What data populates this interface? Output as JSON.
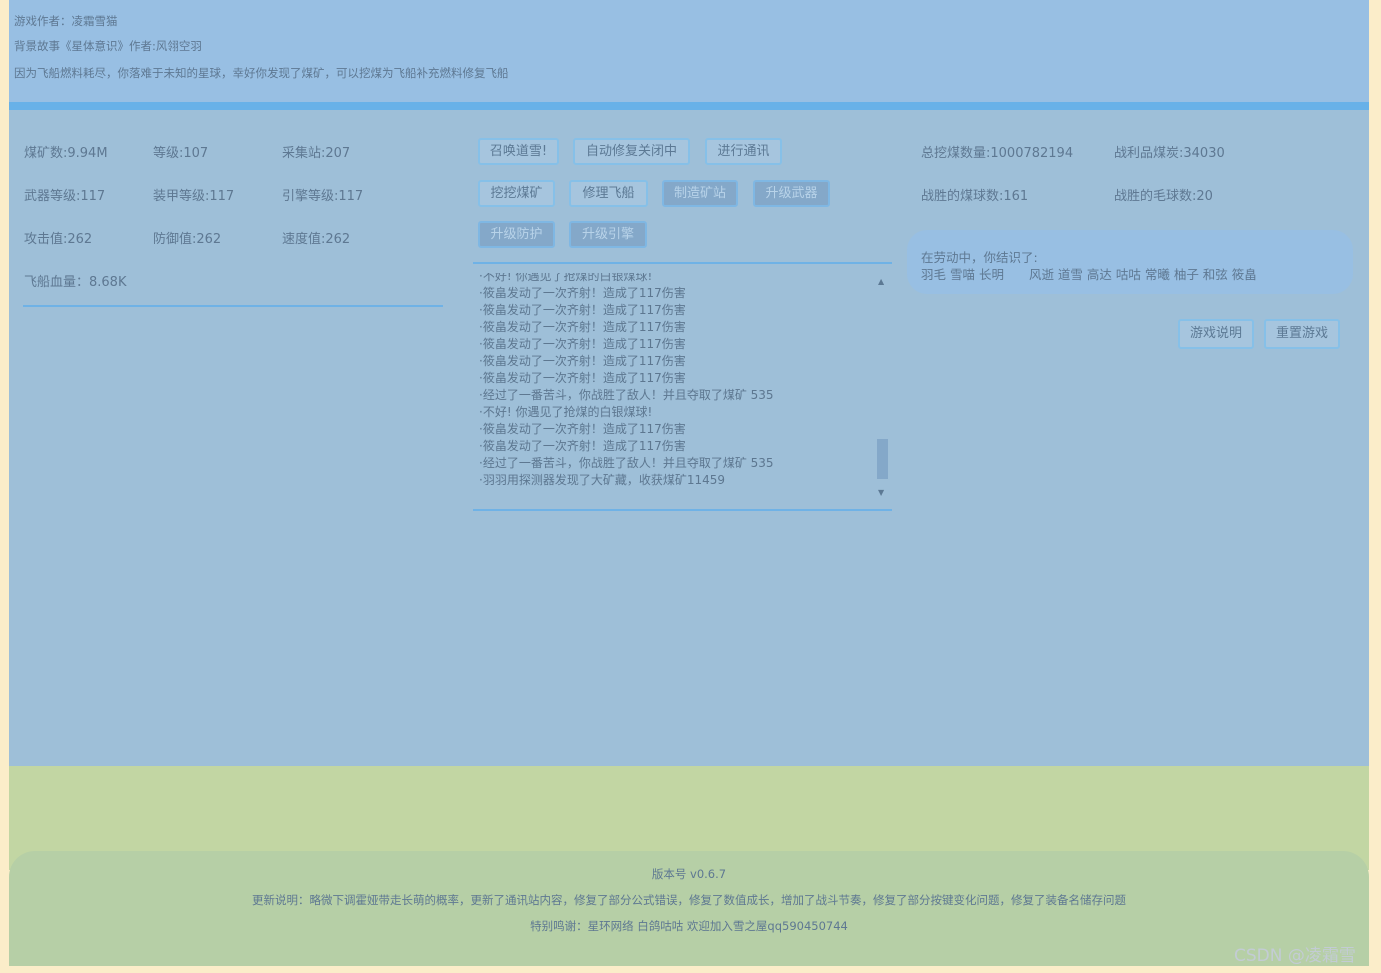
{
  "header": {
    "author": "游戏作者：凌霜雪猫",
    "story": "背景故事《星体意识》作者:风翎空羽",
    "intro": "因为飞船燃料耗尽，你落难于未知的星球，幸好你发现了煤矿，可以挖煤为飞船补充燃料修复飞船"
  },
  "stats": {
    "coal": "煤矿数:9.94M",
    "level": "等级:107",
    "stations": "采集站:207",
    "weapon": "武器等级:117",
    "armor": "装甲等级:117",
    "engine": "引擎等级:117",
    "attack": "攻击值:262",
    "defense": "防御值:262",
    "speed": "速度值:262",
    "hp": "飞船血量：8.68K"
  },
  "buttons": {
    "summon": "召唤道雪!",
    "autorepair": "自动修复关闭中",
    "comm": "进行通讯",
    "mine": "挖挖煤矿",
    "repair": "修理飞船",
    "build": "制造矿站",
    "upgrade_weapon": "升级武器",
    "upgrade_defense": "升级防护",
    "upgrade_engine": "升级引擎",
    "help": "游戏说明",
    "reset": "重置游戏"
  },
  "log": [
    "·不好! 你遇见了抢煤的白银煤球!",
    "·筱畠发动了一次齐射！造成了117伤害",
    "·筱畠发动了一次齐射！造成了117伤害",
    "·筱畠发动了一次齐射！造成了117伤害",
    "·筱畠发动了一次齐射！造成了117伤害",
    "·筱畠发动了一次齐射！造成了117伤害",
    "·筱畠发动了一次齐射！造成了117伤害",
    "·经过了一番苦斗，你战胜了敌人！并且夺取了煤矿 535",
    "·不好! 你遇见了抢煤的白银煤球!",
    "·筱畠发动了一次齐射！造成了117伤害",
    "·筱畠发动了一次齐射！造成了117伤害",
    "·经过了一番苦斗，你战胜了敌人！并且夺取了煤矿 535",
    "·羽羽用探测器发现了大矿藏，收获煤矿11459"
  ],
  "right_stats": {
    "total": "总挖煤数量:1000782194",
    "loot": "战利品煤炭:34030",
    "coal_wins": "战胜的煤球数:161",
    "fur_wins": "战胜的毛球数:20"
  },
  "friends": {
    "title": "在劳动中，你结识了:",
    "names": "羽毛 雪喵 长明　　风逝 道雪 高达 咕咕 常曦 柚子 和弦 筱畠"
  },
  "footer": {
    "version": "版本号 v0.6.7",
    "update": "更新说明：略微下调霍娅带走长萌的概率，更新了通讯站内容，修复了部分公式错误，修复了数值成长，增加了战斗节奏，修复了部分按键变化问题，修复了装备名储存问题",
    "thanks": "特别鸣谢：星环网络 白鸽咕咕 欢迎加入雪之屋qq590450744"
  },
  "watermark": "CSDN @凌霜雪"
}
